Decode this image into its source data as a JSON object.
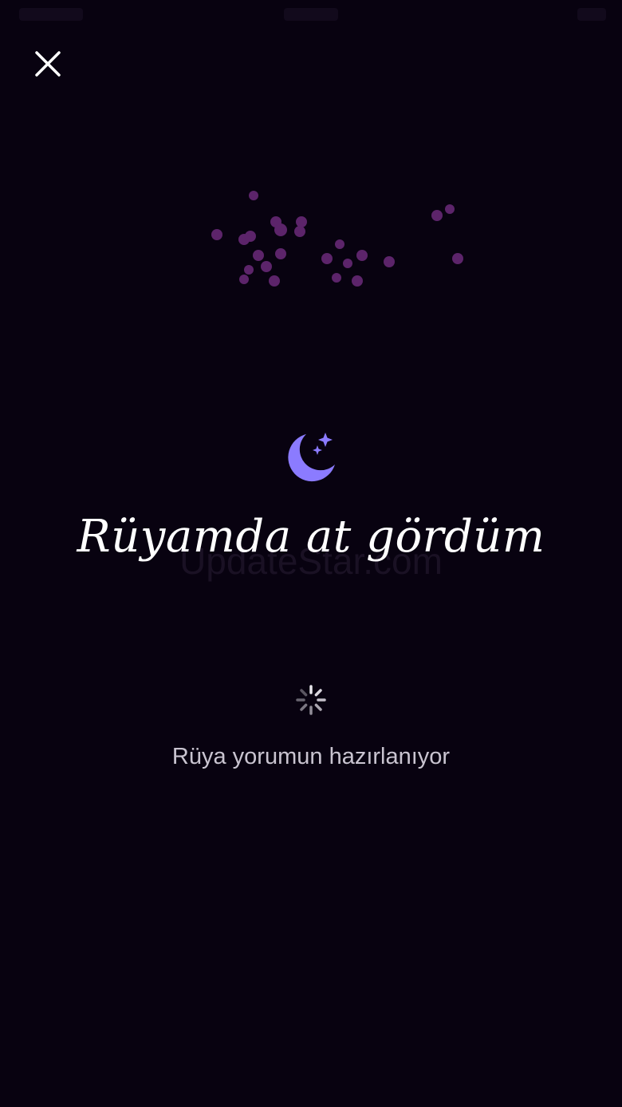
{
  "screen": {
    "title": "Rüyamda at gördüm",
    "loading_text": "Rüya yorumun hazırlanıyor",
    "watermark": "UpdateStar.com"
  },
  "icons": {
    "close": "close-icon",
    "moon": "moon-stars-icon",
    "spinner": "spinner-icon"
  },
  "colors": {
    "background": "#080210",
    "moon": "#8b7bff",
    "particles": "#6b2a7a",
    "loading_text": "#c9c4d0"
  }
}
